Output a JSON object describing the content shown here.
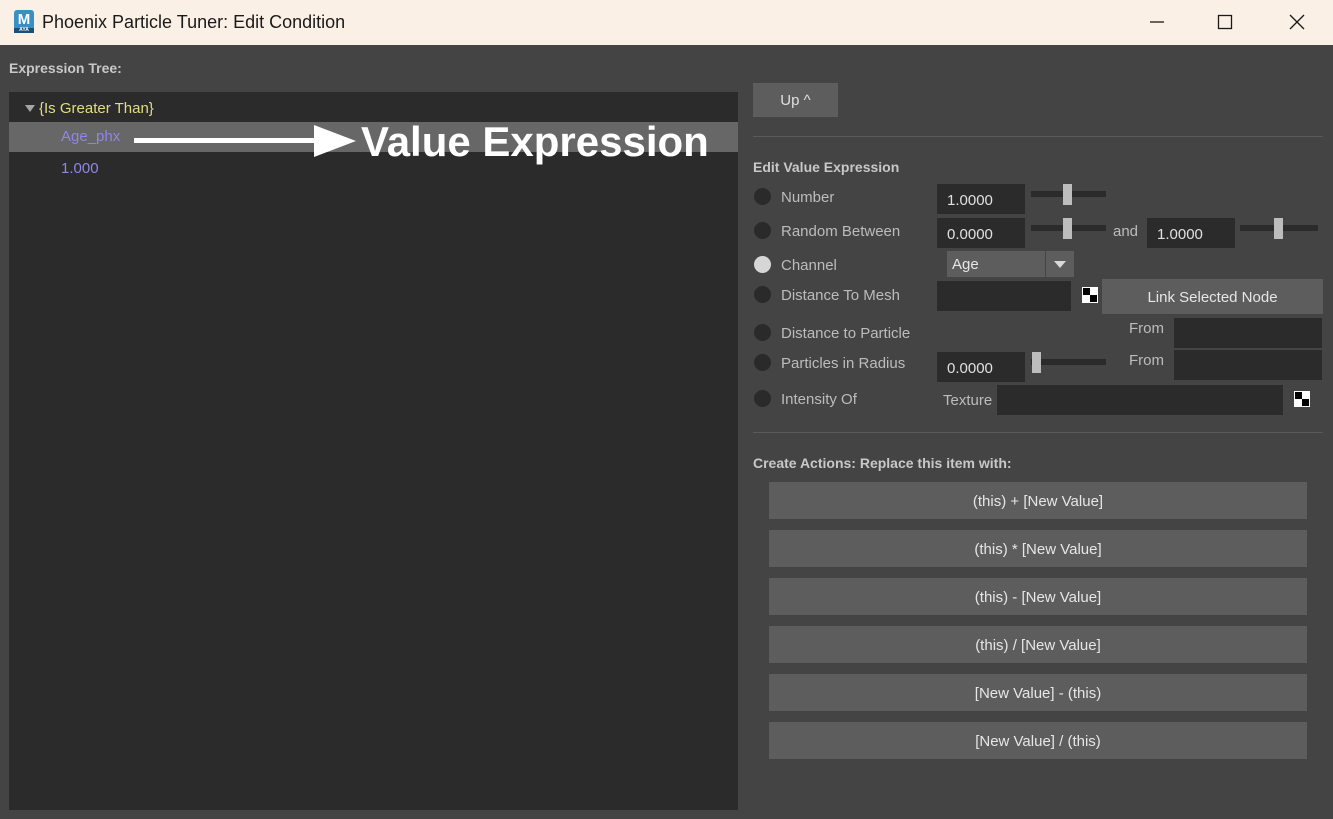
{
  "window": {
    "title": "Phoenix Particle Tuner: Edit Condition",
    "icon_letter": "M",
    "icon_sub": "AYA"
  },
  "tree": {
    "section_label": "Expression Tree:",
    "root_label": "{Is Greater Than}",
    "children": [
      "Age_phx",
      "1.000"
    ],
    "selected_index": 0
  },
  "annotation": {
    "text": "Value Expression"
  },
  "up_button": {
    "label": "Up ^"
  },
  "edit": {
    "heading": "Edit Value Expression",
    "selected_option": "Channel",
    "options": {
      "number": {
        "label": "Number",
        "value": "1.0000",
        "slider": 0.5
      },
      "random_between": {
        "label": "Random Between",
        "value_min": "0.0000",
        "slider_min": 0.5,
        "and_label": "and",
        "value_max": "1.0000",
        "slider_max": 0.5
      },
      "channel": {
        "label": "Channel",
        "selected": "Age"
      },
      "distance_to_mesh": {
        "label": "Distance To Mesh",
        "value": "",
        "link_button": "Link Selected Node"
      },
      "distance_to_particle": {
        "label": "Distance to Particle",
        "from_label": "From",
        "from_value": ""
      },
      "particles_in_radius": {
        "label": "Particles in Radius",
        "value": "0.0000",
        "slider": 0.0,
        "from_label": "From",
        "from_value": ""
      },
      "intensity_of": {
        "label": "Intensity Of",
        "texture_label": "Texture",
        "texture_value": ""
      }
    }
  },
  "actions": {
    "heading": "Create Actions: Replace this item with:",
    "buttons": [
      "(this) + [New Value]",
      "(this) * [New Value]",
      "(this) - [New Value]",
      "(this) / [New Value]",
      "[New Value] - (this)",
      "[New Value] / (this)"
    ]
  }
}
